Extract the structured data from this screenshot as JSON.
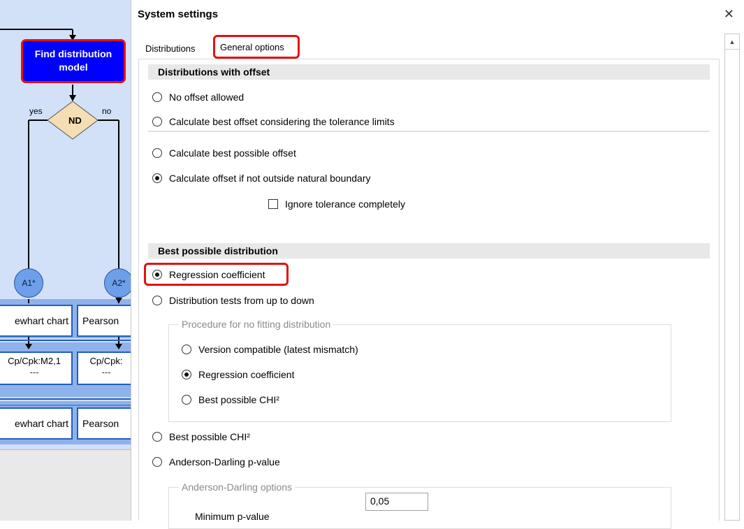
{
  "flowchart": {
    "find_model": "Find distribution model",
    "decision": "ND",
    "yes_label": "yes",
    "no_label": "no",
    "connector_a1": "A1*",
    "connector_a2": "A2*",
    "row1_left": "ewhart chart",
    "row1_right": "Pearson",
    "row2_left_line1": "Cp/Cpk:M2,1",
    "row2_left_line2": "---",
    "row2_right_line1": "Cp/Cpk:",
    "row2_right_line2": "---",
    "row3_left": "ewhart chart",
    "row3_right": "Pearson"
  },
  "dialog": {
    "title": "System settings",
    "close_glyph": "✕",
    "tabs": [
      {
        "label": "Distributions",
        "active": false
      },
      {
        "label": "General options",
        "active": true
      }
    ],
    "sections": {
      "offset": {
        "header": "Distributions with offset",
        "options": [
          {
            "label": "No offset allowed",
            "selected": false
          },
          {
            "label": "Calculate best offset considering the tolerance limits",
            "selected": false
          },
          {
            "label": "Calculate best possible offset",
            "selected": false
          },
          {
            "label": "Calculate offset if not outside natural boundary",
            "selected": true
          }
        ],
        "ignore_tolerance": {
          "label": "Ignore tolerance completely",
          "checked": false
        }
      },
      "best_distribution": {
        "header": "Best possible distribution",
        "options": [
          {
            "label": "Regression coefficient",
            "selected": true
          },
          {
            "label": "Distribution tests from up to down",
            "selected": false
          },
          {
            "label": "Best possible CHI²",
            "selected": false
          },
          {
            "label": "Anderson-Darling p-value",
            "selected": false
          }
        ],
        "procedure_group": {
          "title": "Procedure for no fitting distribution",
          "options": [
            {
              "label": "Version compatible (latest mismatch)",
              "selected": false
            },
            {
              "label": "Regression coefficient",
              "selected": true
            },
            {
              "label": "Best possible CHI²",
              "selected": false
            }
          ]
        },
        "ad_group": {
          "title": "Anderson-Darling options",
          "min_p_label": "Minimum p-value",
          "min_p_value": "0,05"
        }
      }
    }
  },
  "colors": {
    "accent_red": "#e21212",
    "flow_blue": "#0000ff",
    "flow_bg": "#d2e0f8",
    "diamond_fill": "#f5deb3"
  }
}
